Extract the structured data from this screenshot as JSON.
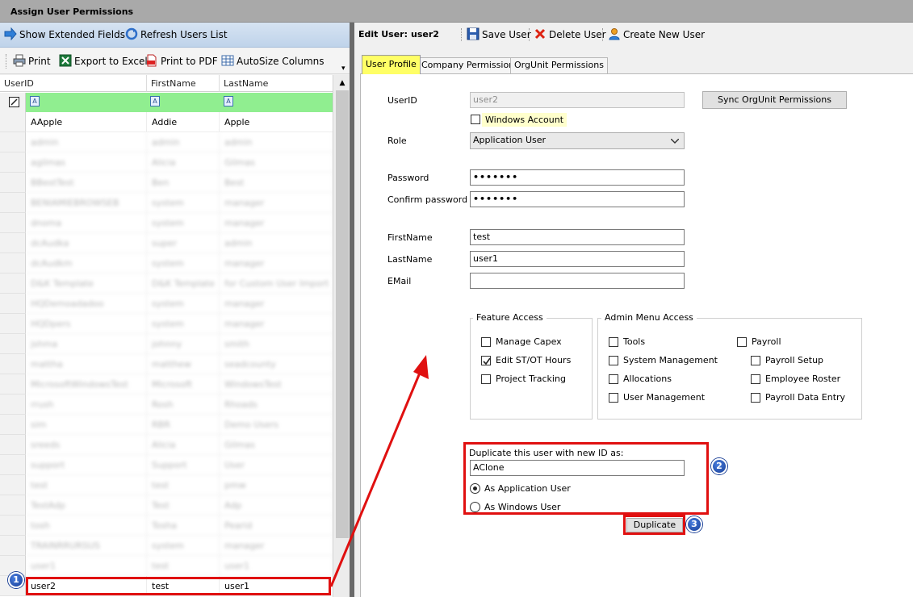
{
  "window": {
    "title": "Assign User Permissions"
  },
  "left_toolbar": {
    "show_extended_fields": "Show Extended Fields",
    "refresh_users_list": "Refresh Users List",
    "print": "Print",
    "export_to_excel": "Export to Excel",
    "print_to_pdf": "Print to PDF",
    "autosize_columns": "AutoSize Columns"
  },
  "grid": {
    "columns": [
      "UserID",
      "FirstName",
      "LastName"
    ],
    "filter_icon_letter": "A",
    "rows": [
      [
        "AApple",
        "Addie",
        "Apple"
      ],
      [
        "admin",
        "admin",
        "admin"
      ],
      [
        "agilmas",
        "Alicia",
        "Gilmas"
      ],
      [
        "BBestTest",
        "Ben",
        "Best"
      ],
      [
        "BENIAMIEBROWSEB",
        "system",
        "manager"
      ],
      [
        "dnoma",
        "system",
        "manager"
      ],
      [
        "dcAudka",
        "super",
        "admin"
      ],
      [
        "dcAudkm",
        "system",
        "manager"
      ],
      [
        "D&K Template",
        "D&K Template",
        "for Custom User Import"
      ],
      [
        "HQDemoadadoo",
        "system",
        "manager"
      ],
      [
        "HQDpers",
        "system",
        "manager"
      ],
      [
        "jshma",
        "johnny",
        "smith"
      ],
      [
        "mattha",
        "matthew",
        "seadcounty"
      ],
      [
        "MicrosoftWindowsTest",
        "Microsoft",
        "WindowsTest"
      ],
      [
        "rrush",
        "Rosh",
        "Rhoads"
      ],
      [
        "sim",
        "RBR",
        "Demo Users"
      ],
      [
        "sreeds",
        "Alicia",
        "Gilmas"
      ],
      [
        "support",
        "Support",
        "User"
      ],
      [
        "test",
        "test",
        "pmw"
      ],
      [
        "TestAdp",
        "Test",
        "Adp"
      ],
      [
        "tosh",
        "Tosha",
        "Pearid"
      ],
      [
        "TRAINRRURSUS",
        "system",
        "manager"
      ],
      [
        "user1",
        "test",
        "user1"
      ],
      [
        "user2",
        "test",
        "user1"
      ]
    ]
  },
  "right_toolbar": {
    "edit_user_label": "Edit User:",
    "edit_user_value": "user2",
    "save_user": "Save User",
    "delete_user": "Delete User",
    "create_new_user": "Create New User"
  },
  "tabs": [
    "User Profile",
    "Company Permissions",
    "OrgUnit Permissions"
  ],
  "form": {
    "userid_label": "UserID",
    "userid_value": "user2",
    "sync_button": "Sync OrgUnit Permissions",
    "windows_account": "Windows Account",
    "role_label": "Role",
    "role_value": "Application User",
    "password_label": "Password",
    "password_value": "•••••••",
    "confirm_label": "Confirm password",
    "confirm_value": "•••••••",
    "firstname_label": "FirstName",
    "firstname_value": "test",
    "lastname_label": "LastName",
    "lastname_value": "user1",
    "email_label": "EMail",
    "email_value": ""
  },
  "feature_access": {
    "title": "Feature Access",
    "items": [
      {
        "label": "Manage Capex",
        "checked": false
      },
      {
        "label": "Edit ST/OT Hours",
        "checked": true
      },
      {
        "label": "Project Tracking",
        "checked": false
      }
    ]
  },
  "admin_menu": {
    "title": "Admin Menu Access",
    "col1": [
      {
        "label": "Tools",
        "checked": false
      },
      {
        "label": "System Management",
        "checked": false
      },
      {
        "label": "Allocations",
        "checked": false
      },
      {
        "label": "User Management",
        "checked": false
      }
    ],
    "payroll": {
      "label": "Payroll",
      "checked": false
    },
    "col2": [
      {
        "label": "Payroll Setup",
        "checked": false
      },
      {
        "label": "Employee Roster",
        "checked": false
      },
      {
        "label": "Payroll Data Entry",
        "checked": false
      }
    ]
  },
  "duplicate": {
    "label": "Duplicate this user with new ID as:",
    "new_id": "AClone",
    "option_app": "As Application User",
    "option_win": "As Windows User",
    "button": "Duplicate"
  },
  "callouts": [
    "1",
    "2",
    "3"
  ],
  "colors": {
    "filter_row": "#90ee90",
    "tab_active": "#ffff66",
    "callout_red": "#e01010",
    "badge_blue": "#1f4fb0"
  }
}
